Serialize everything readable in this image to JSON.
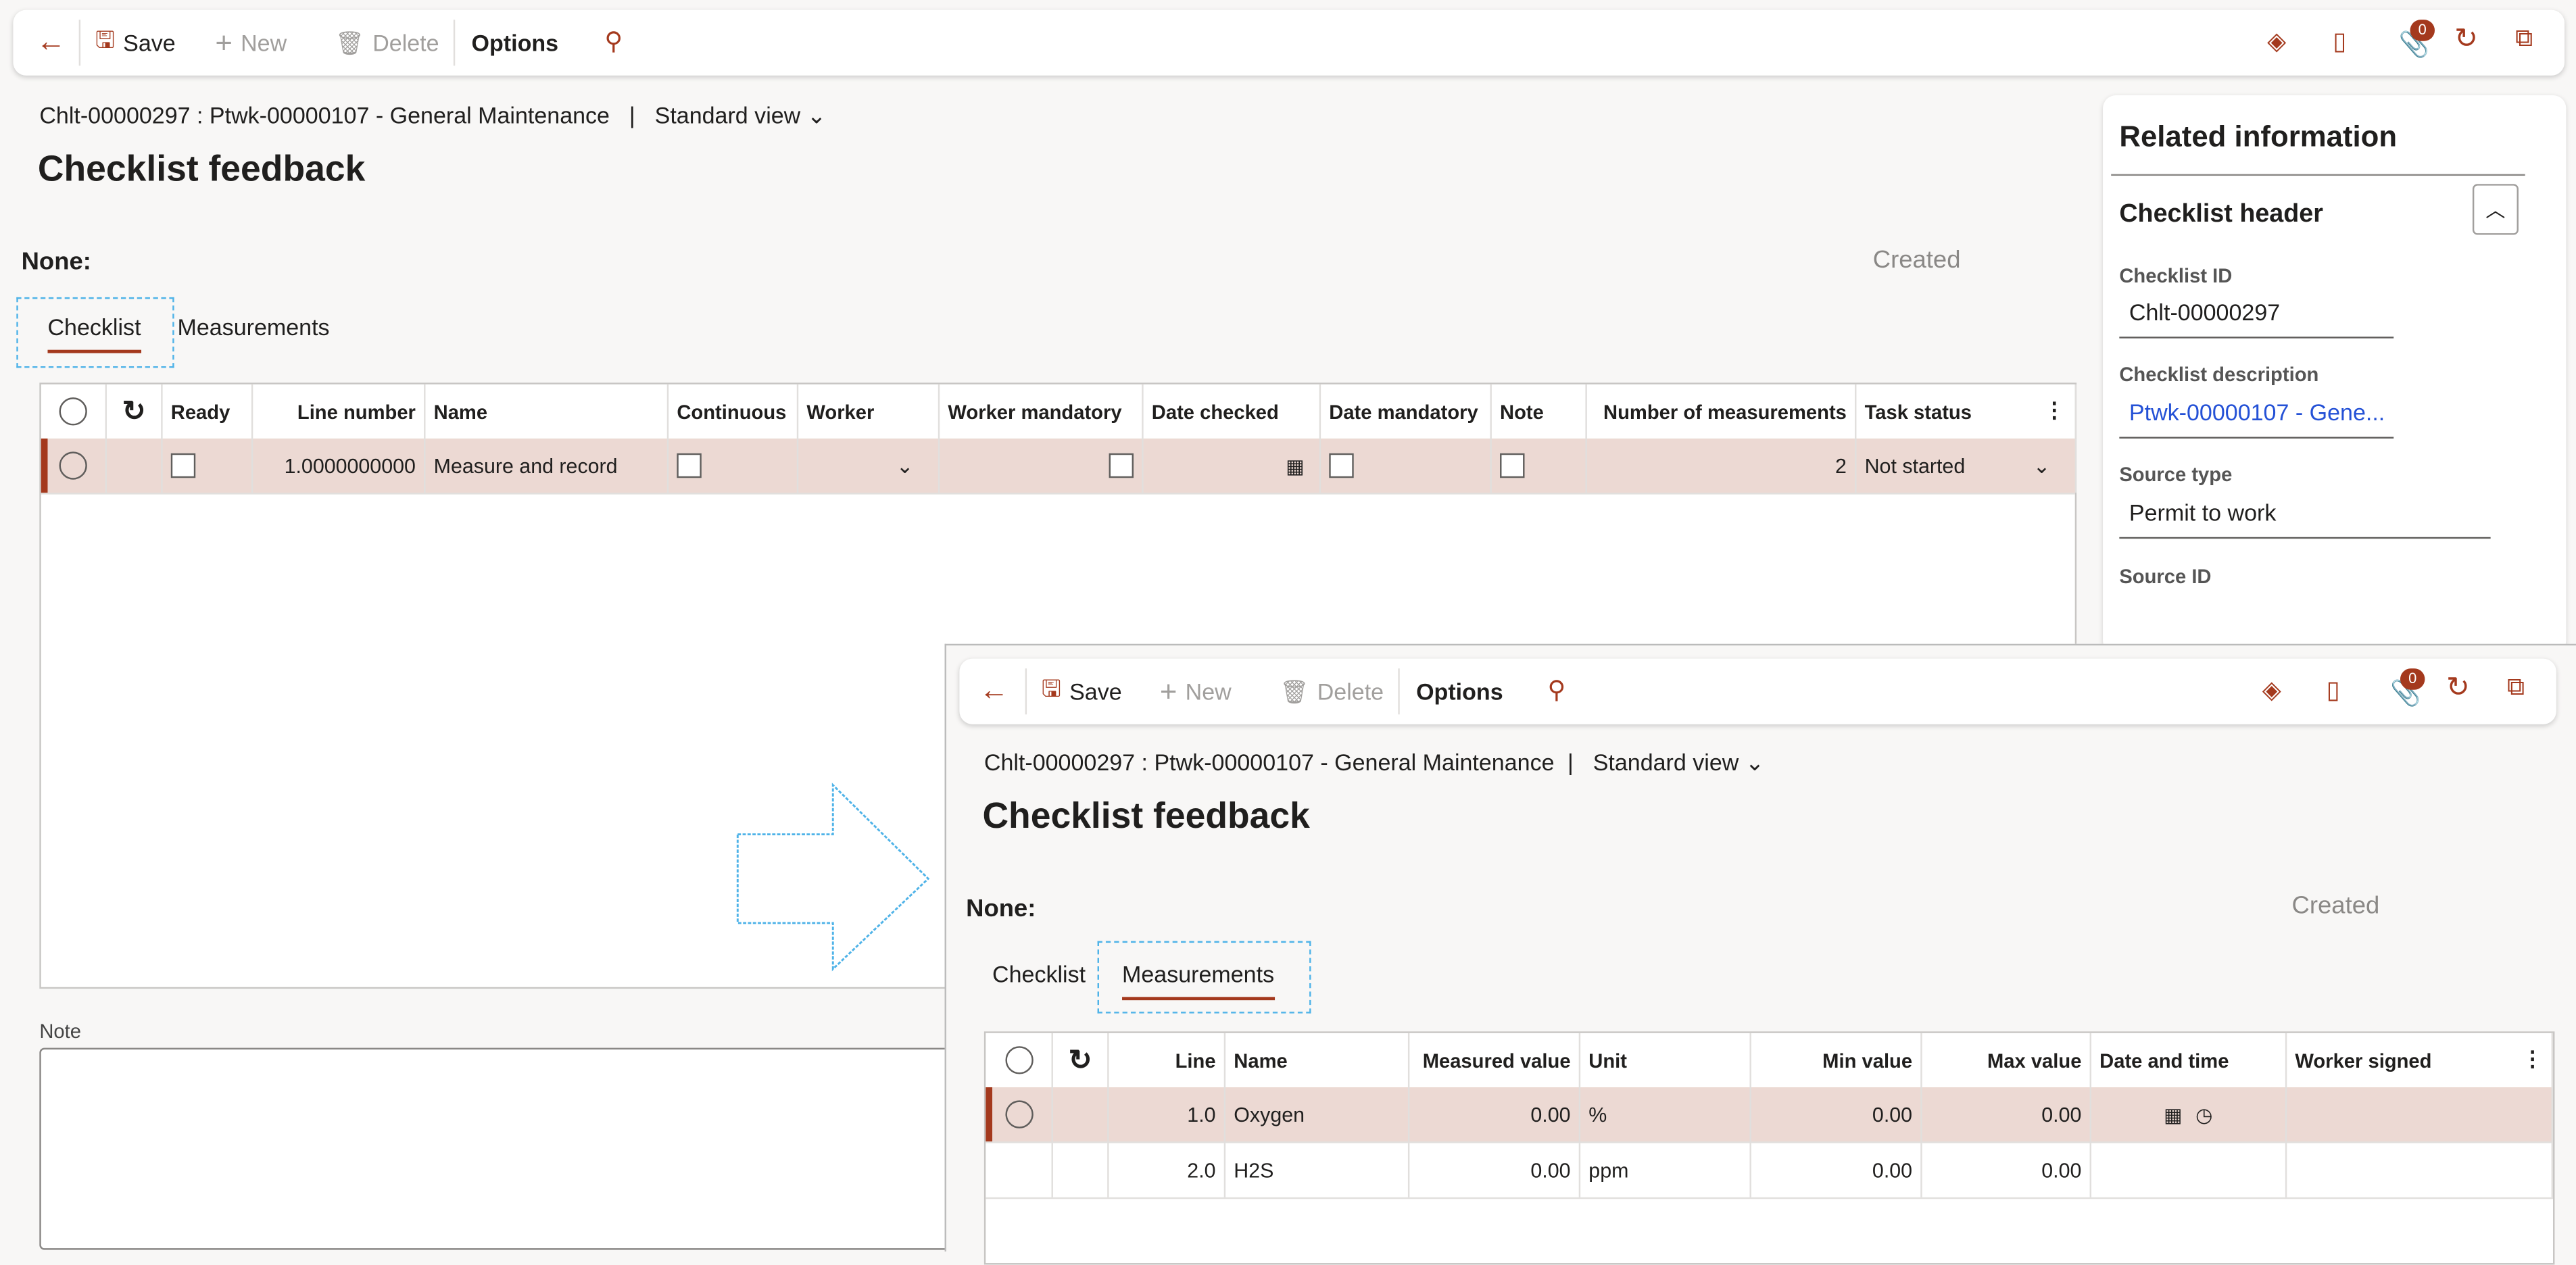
{
  "toolbar": {
    "save": "Save",
    "new": "New",
    "delete": "Delete",
    "options": "Options",
    "attachments_count": "0"
  },
  "breadcrumb": {
    "path": "Chlt-00000297 : Ptwk-00000107 - General Maintenance",
    "view": "Standard view"
  },
  "page_title": "Checklist feedback",
  "group_label": "None:",
  "status": "Created",
  "tabs": [
    "Checklist",
    "Measurements"
  ],
  "checklist_grid": {
    "columns": [
      "Ready",
      "Line number",
      "Name",
      "Continuous",
      "Worker",
      "Worker mandatory",
      "Date checked",
      "Date mandatory",
      "Note",
      "Number of measurements",
      "Task status"
    ],
    "rows": [
      {
        "ready": false,
        "line_number": "1.0000000000",
        "name": "Measure and record",
        "continuous": false,
        "worker": "",
        "worker_mandatory": false,
        "date_checked": "",
        "date_mandatory": false,
        "note": false,
        "number_of_measurements": "2",
        "task_status": "Not started"
      }
    ]
  },
  "note_label": "Note",
  "related": {
    "title": "Related information",
    "section": "Checklist header",
    "fields": [
      {
        "label": "Checklist ID",
        "value": "Chlt-00000297"
      },
      {
        "label": "Checklist description",
        "value": "Ptwk-00000107 - Gene..."
      },
      {
        "label": "Source type",
        "value": "Permit to work"
      },
      {
        "label": "Source ID",
        "value": ""
      }
    ]
  },
  "measurements_grid": {
    "columns": [
      "Line",
      "Name",
      "Measured value",
      "Unit",
      "Min value",
      "Max value",
      "Date and time",
      "Worker signed"
    ],
    "rows": [
      {
        "line": "1.0",
        "name": "Oxygen",
        "measured_value": "0.00",
        "unit": "%",
        "min_value": "0.00",
        "max_value": "0.00",
        "date_and_time": "",
        "worker_signed": ""
      },
      {
        "line": "2.0",
        "name": "H2S",
        "measured_value": "0.00",
        "unit": "ppm",
        "min_value": "0.00",
        "max_value": "0.00",
        "date_and_time": "",
        "worker_signed": ""
      }
    ]
  },
  "colors": {
    "accent": "#a4391d",
    "link": "#2451d6",
    "focus": "#4fb3e8",
    "selected_row": "#ecd9d3"
  }
}
